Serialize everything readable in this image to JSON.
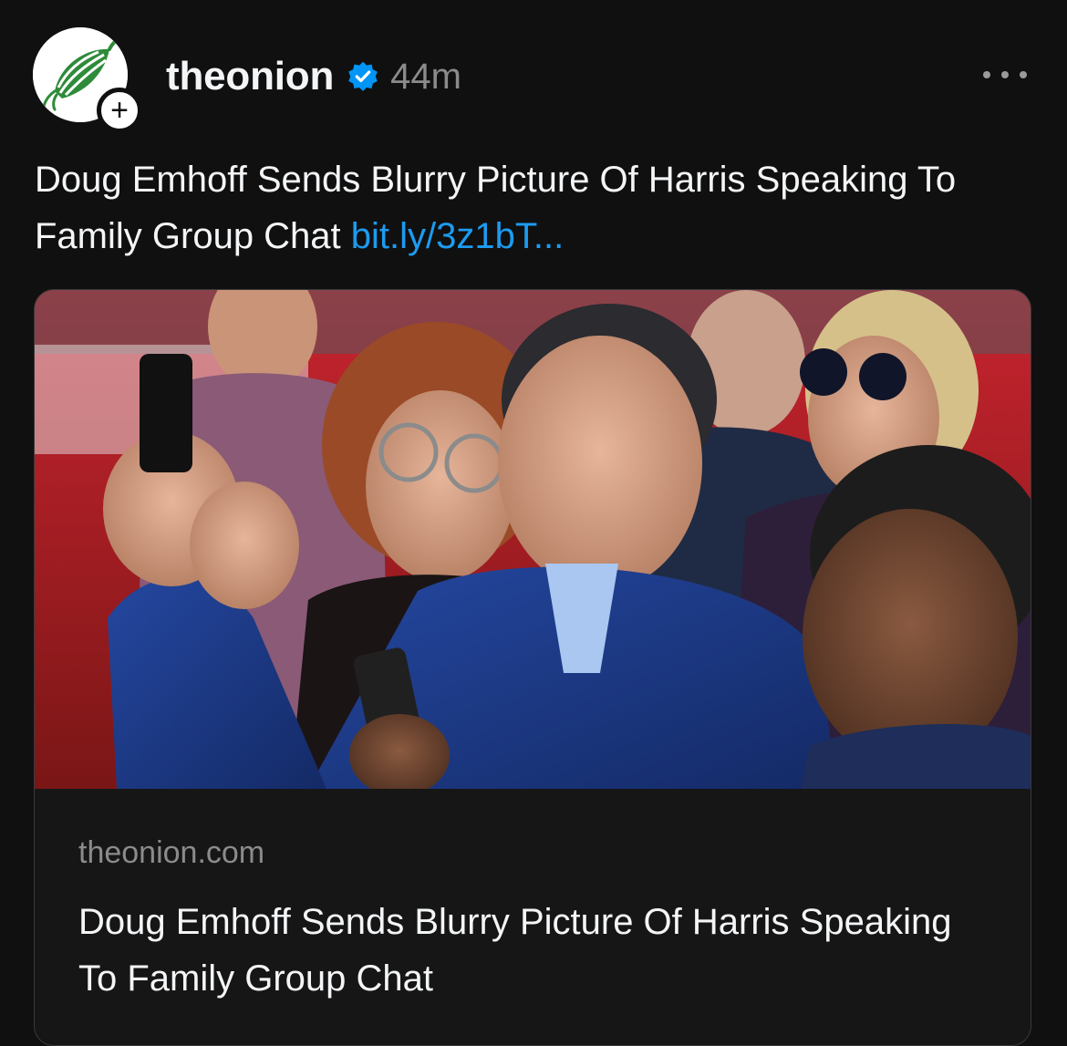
{
  "post": {
    "username": "theonion",
    "verified_icon": "verified-badge-icon",
    "timestamp": "44m",
    "follow_icon": "+",
    "more_icon": "more-dots-icon",
    "text": "Doug Emhoff Sends Blurry Picture Of Harris Speaking To Family Group Chat",
    "link_text": "bit.ly/3z1bT..."
  },
  "link_card": {
    "domain": "theonion.com",
    "title": "Doug Emhoff Sends Blurry Picture Of Harris Speaking To Family Group Chat"
  },
  "colors": {
    "background": "#101010",
    "text": "#f3f5f7",
    "muted": "#8b8b8b",
    "link": "#1d9bf0",
    "verified": "#0095f6",
    "onion_green": "#2e8b3a"
  }
}
